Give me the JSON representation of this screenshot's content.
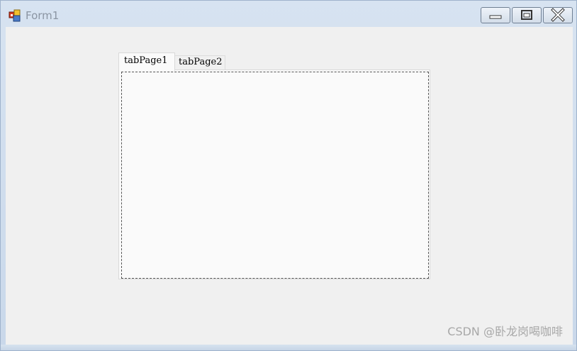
{
  "window": {
    "title": "Form1",
    "buttons": {
      "minimize": "minimize-icon",
      "maximize": "maximize-icon",
      "close": "close-icon"
    }
  },
  "tabcontrol": {
    "tabs": [
      {
        "label": "tabPage1",
        "selected": true
      },
      {
        "label": "tabPage2",
        "selected": false
      }
    ]
  },
  "watermark": "CSDN @卧龙岗喝咖啡",
  "colors": {
    "client_bg": "#f0f0f0",
    "tab_page_bg": "#fafafa",
    "titlebar_bg": "#d7e3f1"
  }
}
